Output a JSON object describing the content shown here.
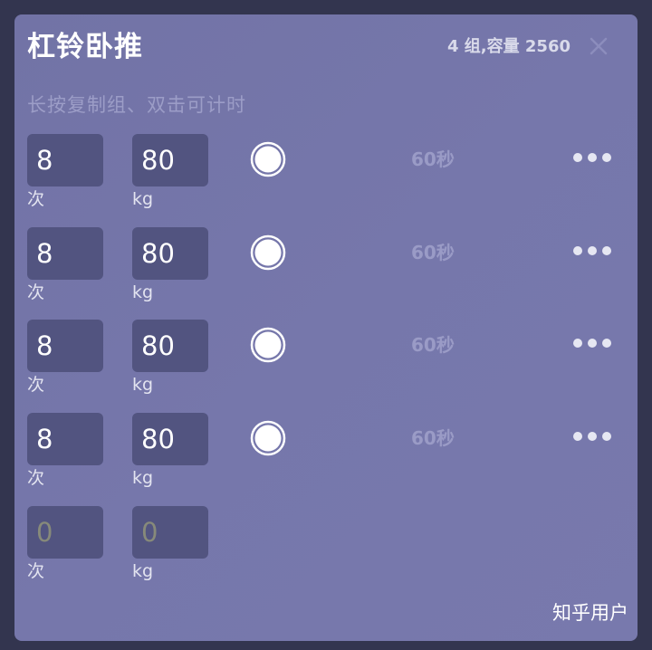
{
  "header": {
    "title": "杠铃卧推",
    "summary": "4 组,容量 2560",
    "close_icon": "close-icon"
  },
  "hint": "长按复制组、双击可计时",
  "sets": [
    {
      "reps": "8",
      "weight": "80",
      "reps_unit": "次",
      "weight_unit": "kg",
      "rest": "60秒",
      "completed": true
    },
    {
      "reps": "8",
      "weight": "80",
      "reps_unit": "次",
      "weight_unit": "kg",
      "rest": "60秒",
      "completed": true
    },
    {
      "reps": "8",
      "weight": "80",
      "reps_unit": "次",
      "weight_unit": "kg",
      "rest": "60秒",
      "completed": true
    },
    {
      "reps": "8",
      "weight": "80",
      "reps_unit": "次",
      "weight_unit": "kg",
      "rest": "60秒",
      "completed": true
    }
  ],
  "new_set": {
    "reps_placeholder": "0",
    "weight_placeholder": "0",
    "reps_unit": "次",
    "weight_unit": "kg"
  },
  "watermark": "知乎用户",
  "colors": {
    "background": "#33354f",
    "card": "#7677ab",
    "input": "#525480",
    "placeholder": "#878a7a"
  },
  "icons": {
    "check": "circle-check-icon",
    "more": "more-horizontal-icon"
  }
}
